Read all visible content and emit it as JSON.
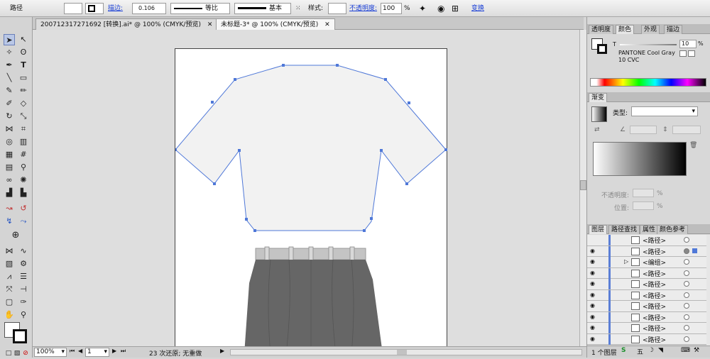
{
  "control_bar": {
    "object_type": "路径",
    "stroke_label": "描边:",
    "stroke_weight": "0.106",
    "profile_label": "等比",
    "brush_label": "基本",
    "style_label": "样式:",
    "opacity_label": "不透明度:",
    "opacity_value": "100",
    "opacity_unit": "%",
    "transform_label": "变换"
  },
  "tabs": [
    {
      "label": "200712317271692 [转换].ai* @ 100% (CMYK/预览)",
      "active": false
    },
    {
      "label": "未标题-3* @ 100% (CMYK/预览)",
      "active": true
    }
  ],
  "color_panel": {
    "tabs": [
      "透明度",
      "颜色",
      "外观",
      "描边"
    ],
    "t_label": "T",
    "tint_value": "10",
    "tint_unit": "%",
    "swatch_name": "PANTONE Cool Gray",
    "swatch_sub": "10 CVC"
  },
  "gradient_panel": {
    "tab": "渐变",
    "type_label": "类型:",
    "opacity_label": "不透明度:",
    "position_label": "位置:",
    "pct": "%"
  },
  "layers_panel": {
    "tabs": [
      "图层",
      "路径查找",
      "属性",
      "颜色参考"
    ],
    "rows": [
      {
        "name": "<路径>",
        "eye": false,
        "target_filled": false
      },
      {
        "name": "<路径>",
        "eye": true,
        "target_filled": true
      },
      {
        "name": "<编组>",
        "eye": true,
        "target_filled": false,
        "group": true
      },
      {
        "name": "<路径>",
        "eye": true,
        "target_filled": false
      },
      {
        "name": "<路径>",
        "eye": true,
        "target_filled": false
      },
      {
        "name": "<路径>",
        "eye": true,
        "target_filled": false
      },
      {
        "name": "<路径>",
        "eye": true,
        "target_filled": false
      },
      {
        "name": "<路径>",
        "eye": true,
        "target_filled": false
      },
      {
        "name": "<路径>",
        "eye": true,
        "target_filled": false
      },
      {
        "name": "<路径>",
        "eye": true,
        "target_filled": false
      }
    ],
    "footer": "1 个图层"
  },
  "status_bar": {
    "zoom": "100%",
    "page": "1",
    "undo_text": "23 次还原; 无重做"
  },
  "colors": {
    "selection_blue": "#4f78d8",
    "shirt_fill": "#f2f2f2",
    "pants_fill": "#666666",
    "belt_fill": "#c4c4c4"
  }
}
